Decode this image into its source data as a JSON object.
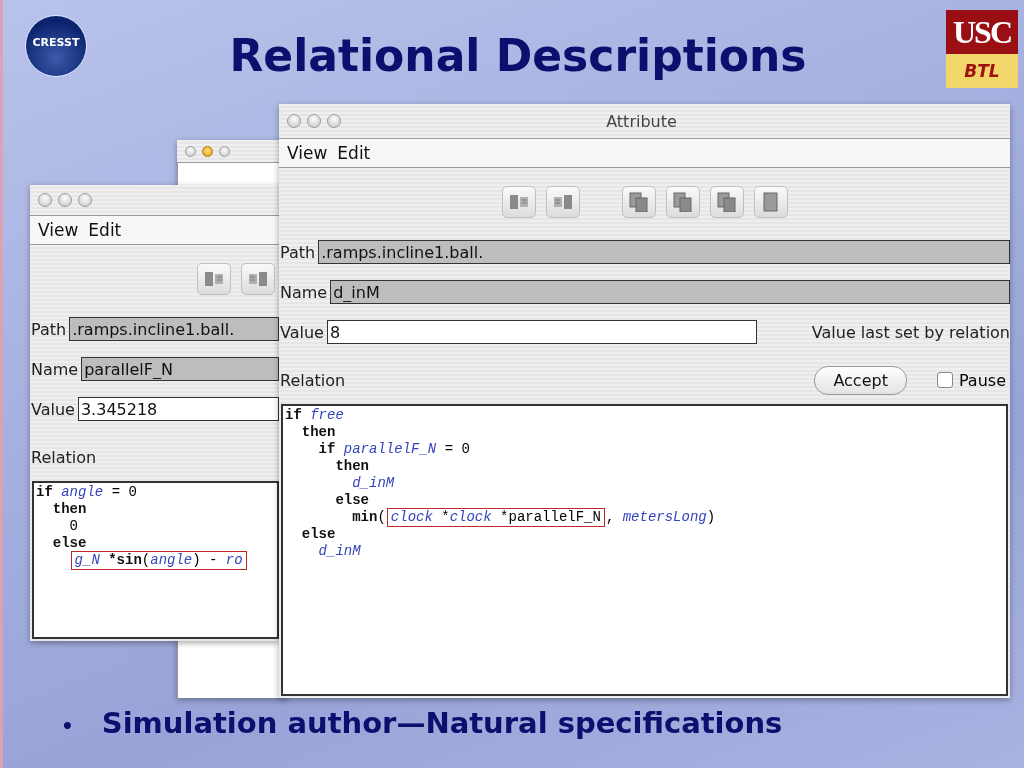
{
  "slide": {
    "title": "Relational Descriptions",
    "logo_left": "CRESST",
    "logo_right": {
      "top": "USC",
      "bottom": "BTL"
    },
    "bullet": {
      "marker": "•",
      "text": "Simulation author—Natural specifications"
    }
  },
  "windows": [
    {
      "kind": "blank",
      "traffic_lights": [
        {
          "lit": false
        },
        {
          "lit": true
        },
        {
          "lit": false
        }
      ]
    },
    {
      "kind": "editor",
      "traffic_lights": [
        {
          "lit": false
        },
        {
          "lit": false
        },
        {
          "lit": false
        }
      ],
      "menu": [
        "View",
        "Edit"
      ],
      "toolbar": [
        {
          "kind": "split-left"
        },
        {
          "kind": "split-right"
        }
      ],
      "fields": [
        {
          "label": "Path",
          "value": ".ramps.incline1.ball.",
          "editable": false
        },
        {
          "label": "Name",
          "value": "parallelF_N",
          "editable": false
        },
        {
          "label": "Value",
          "value": "3.345218",
          "editable": true
        }
      ],
      "relation_label": "Relation",
      "code": [
        {
          "tokens": [
            {
              "text": "if ",
              "kind": "keyword"
            },
            {
              "text": "angle",
              "kind": "ident"
            },
            {
              "text": " = 0",
              "kind": "plain"
            }
          ],
          "children": [
            {
              "tokens": [
                {
                  "text": "then",
                  "kind": "keyword"
                }
              ],
              "children": [
                {
                  "tokens": [
                    {
                      "text": "0",
                      "kind": "plain"
                    }
                  ]
                }
              ]
            },
            {
              "tokens": [
                {
                  "text": "else",
                  "kind": "keyword"
                }
              ],
              "children": [
                {
                  "tokens": [
                    {
                      "kind": "highlight",
                      "tokens": [
                        {
                          "text": "g_N",
                          "kind": "ident"
                        },
                        {
                          "text": " *sin",
                          "kind": "keyword"
                        },
                        {
                          "text": "(",
                          "kind": "plain"
                        },
                        {
                          "text": "angle",
                          "kind": "ident"
                        },
                        {
                          "text": ") - ",
                          "kind": "plain"
                        },
                        {
                          "text": "ro",
                          "kind": "ident"
                        }
                      ]
                    }
                  ]
                }
              ]
            }
          ]
        }
      ]
    },
    {
      "kind": "editor",
      "title": "Attribute",
      "traffic_lights": [
        {
          "lit": false
        },
        {
          "lit": false
        },
        {
          "lit": false
        }
      ],
      "menu": [
        "View",
        "Edit"
      ],
      "toolbar": [
        {
          "kind": "split-left"
        },
        {
          "kind": "split-right"
        },
        {
          "kind": "pages"
        },
        {
          "kind": "pages"
        },
        {
          "kind": "pages"
        },
        {
          "kind": "page"
        }
      ],
      "fields": [
        {
          "label": "Path",
          "value": ".ramps.incline1.ball.",
          "editable": false
        },
        {
          "label": "Name",
          "value": "d_inM",
          "editable": false
        },
        {
          "label": "Value",
          "value": "8",
          "editable": true,
          "note": "Value last set by relation"
        }
      ],
      "relation_label": "Relation",
      "accept": "Accept",
      "pause": {
        "label": "Pause",
        "checked": false
      },
      "code": [
        {
          "tokens": [
            {
              "text": "if ",
              "kind": "keyword"
            },
            {
              "text": "free",
              "kind": "ident"
            }
          ],
          "children": [
            {
              "tokens": [
                {
                  "text": "then",
                  "kind": "keyword"
                }
              ],
              "children": [
                {
                  "tokens": [
                    {
                      "text": "if ",
                      "kind": "keyword"
                    },
                    {
                      "text": "parallelF_N",
                      "kind": "ident"
                    },
                    {
                      "text": " = 0",
                      "kind": "plain"
                    }
                  ],
                  "children": [
                    {
                      "tokens": [
                        {
                          "text": "then",
                          "kind": "keyword"
                        }
                      ],
                      "children": [
                        {
                          "tokens": [
                            {
                              "text": "d_inM",
                              "kind": "ident"
                            }
                          ]
                        }
                      ]
                    },
                    {
                      "tokens": [
                        {
                          "text": "else",
                          "kind": "keyword"
                        }
                      ],
                      "children": [
                        {
                          "tokens": [
                            {
                              "text": "min",
                              "kind": "keyword"
                            },
                            {
                              "text": "(",
                              "kind": "plain"
                            },
                            {
                              "kind": "highlight",
                              "tokens": [
                                {
                                  "text": "clock",
                                  "kind": "ident"
                                },
                                {
                                  "text": " *",
                                  "kind": "plain"
                                },
                                {
                                  "text": "clock",
                                  "kind": "ident"
                                },
                                {
                                  "text": " *parallelF_N",
                                  "kind": "plain"
                                }
                              ]
                            },
                            {
                              "text": ", ",
                              "kind": "plain"
                            },
                            {
                              "text": "metersLong",
                              "kind": "ident"
                            },
                            {
                              "text": ")",
                              "kind": "plain"
                            }
                          ]
                        }
                      ]
                    }
                  ]
                }
              ]
            },
            {
              "tokens": [
                {
                  "text": "else",
                  "kind": "keyword"
                }
              ],
              "children": [
                {
                  "tokens": [
                    {
                      "text": "d_inM",
                      "kind": "ident"
                    }
                  ]
                }
              ]
            }
          ]
        }
      ]
    }
  ]
}
